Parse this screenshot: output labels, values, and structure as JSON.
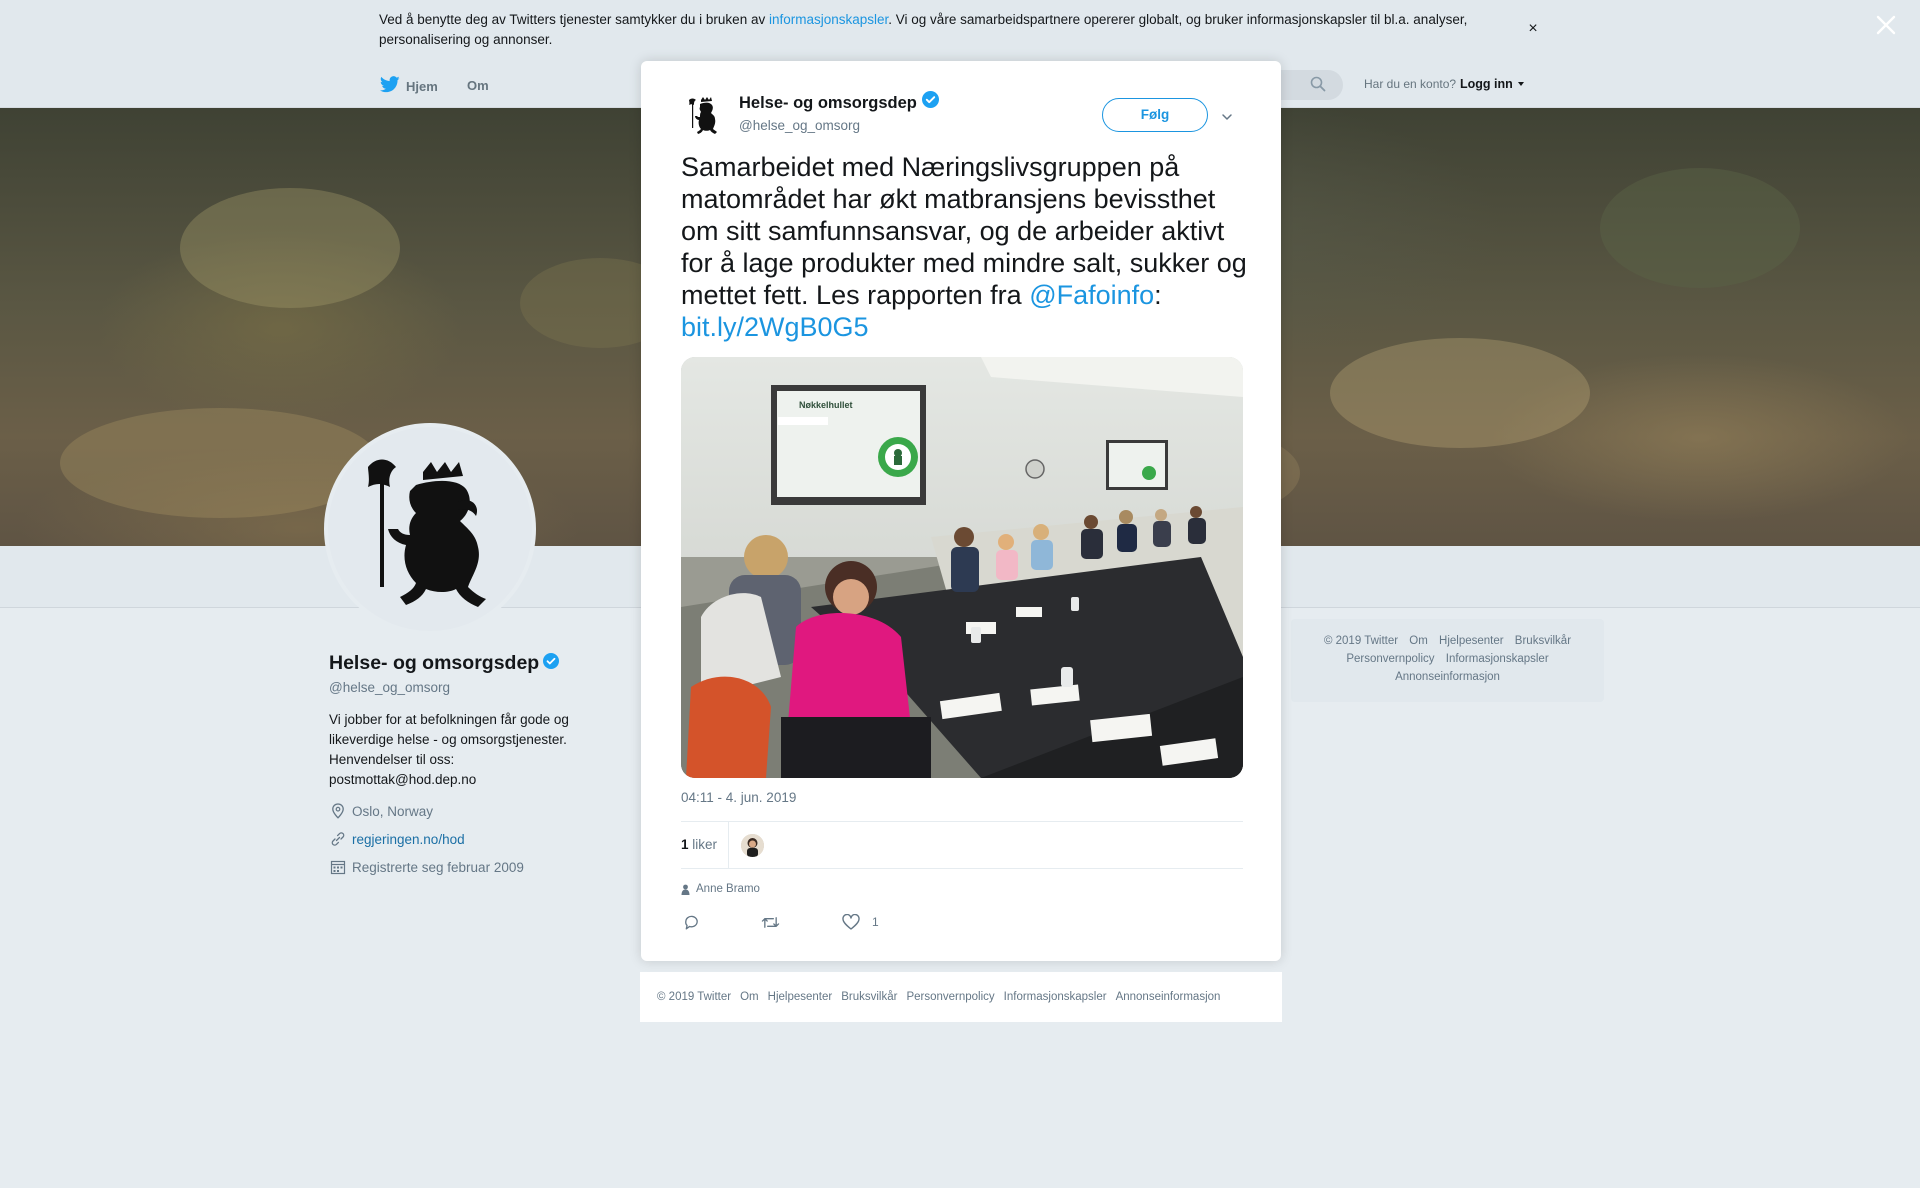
{
  "cookie_banner": {
    "text_before": "Ved å benytte deg av Twitters tjenester samtykker du i bruken av ",
    "link": "informasjonskapsler",
    "text_after": ". Vi og våre samarbeidspartnere opererer globalt, og bruker informasjonskapsler til bl.a. analyser, personalisering og annonser.",
    "close": "×"
  },
  "topnav": {
    "home": "Hjem",
    "about": "Om",
    "account_question": "Har du en konto?",
    "login": "Logg inn"
  },
  "profile": {
    "name": "Helse- og omsorgsdep",
    "handle": "@helse_og_omsorg",
    "bio": "Vi jobber for at befolkningen får gode og likeverdige helse - og omsorgstjenester. Henvendelser til oss: postmottak@hod.dep.no",
    "location": "Oslo, Norway",
    "url": "regjeringen.no/hod",
    "joined": "Registrerte seg februar 2009"
  },
  "side_footer": {
    "links": [
      "© 2019 Twitter",
      "Om",
      "Hjelpesenter",
      "Bruksvilkår",
      "Personvernpolicy",
      "Informasjonskapsler",
      "Annonseinformasjon"
    ]
  },
  "tweet": {
    "name": "Helse- og omsorgsdep",
    "handle": "@helse_og_omsorg",
    "follow": "Følg",
    "text": "Samarbeidet med Næringslivsgruppen på matområdet har økt matbransjens bevissthet om sitt samfunnsansvar, og de arbeider aktivt for å lage produkter med mindre salt, sukker og mettet fett. Les rapporten fra ",
    "mention": "@Fafoinfo",
    "colon": ":",
    "link": "bit.ly/2WgB0G5",
    "photo_screen_title": "Nøkkelhullet",
    "timestamp": "04:11 - 4. jun. 2019",
    "likes_count": "1",
    "likes_label": "liker",
    "reply_to": "Anne Bramo",
    "action_like_count": "1"
  },
  "modal_footer": {
    "links": [
      "© 2019 Twitter",
      "Om",
      "Hjelpesenter",
      "Bruksvilkår",
      "Personvernpolicy",
      "Informasjonskapsler",
      "Annonseinformasjon"
    ]
  },
  "colors": {
    "link_blue": "#1b95e0",
    "verified_blue": "#1da1f2",
    "background": "#e6ecf0"
  }
}
